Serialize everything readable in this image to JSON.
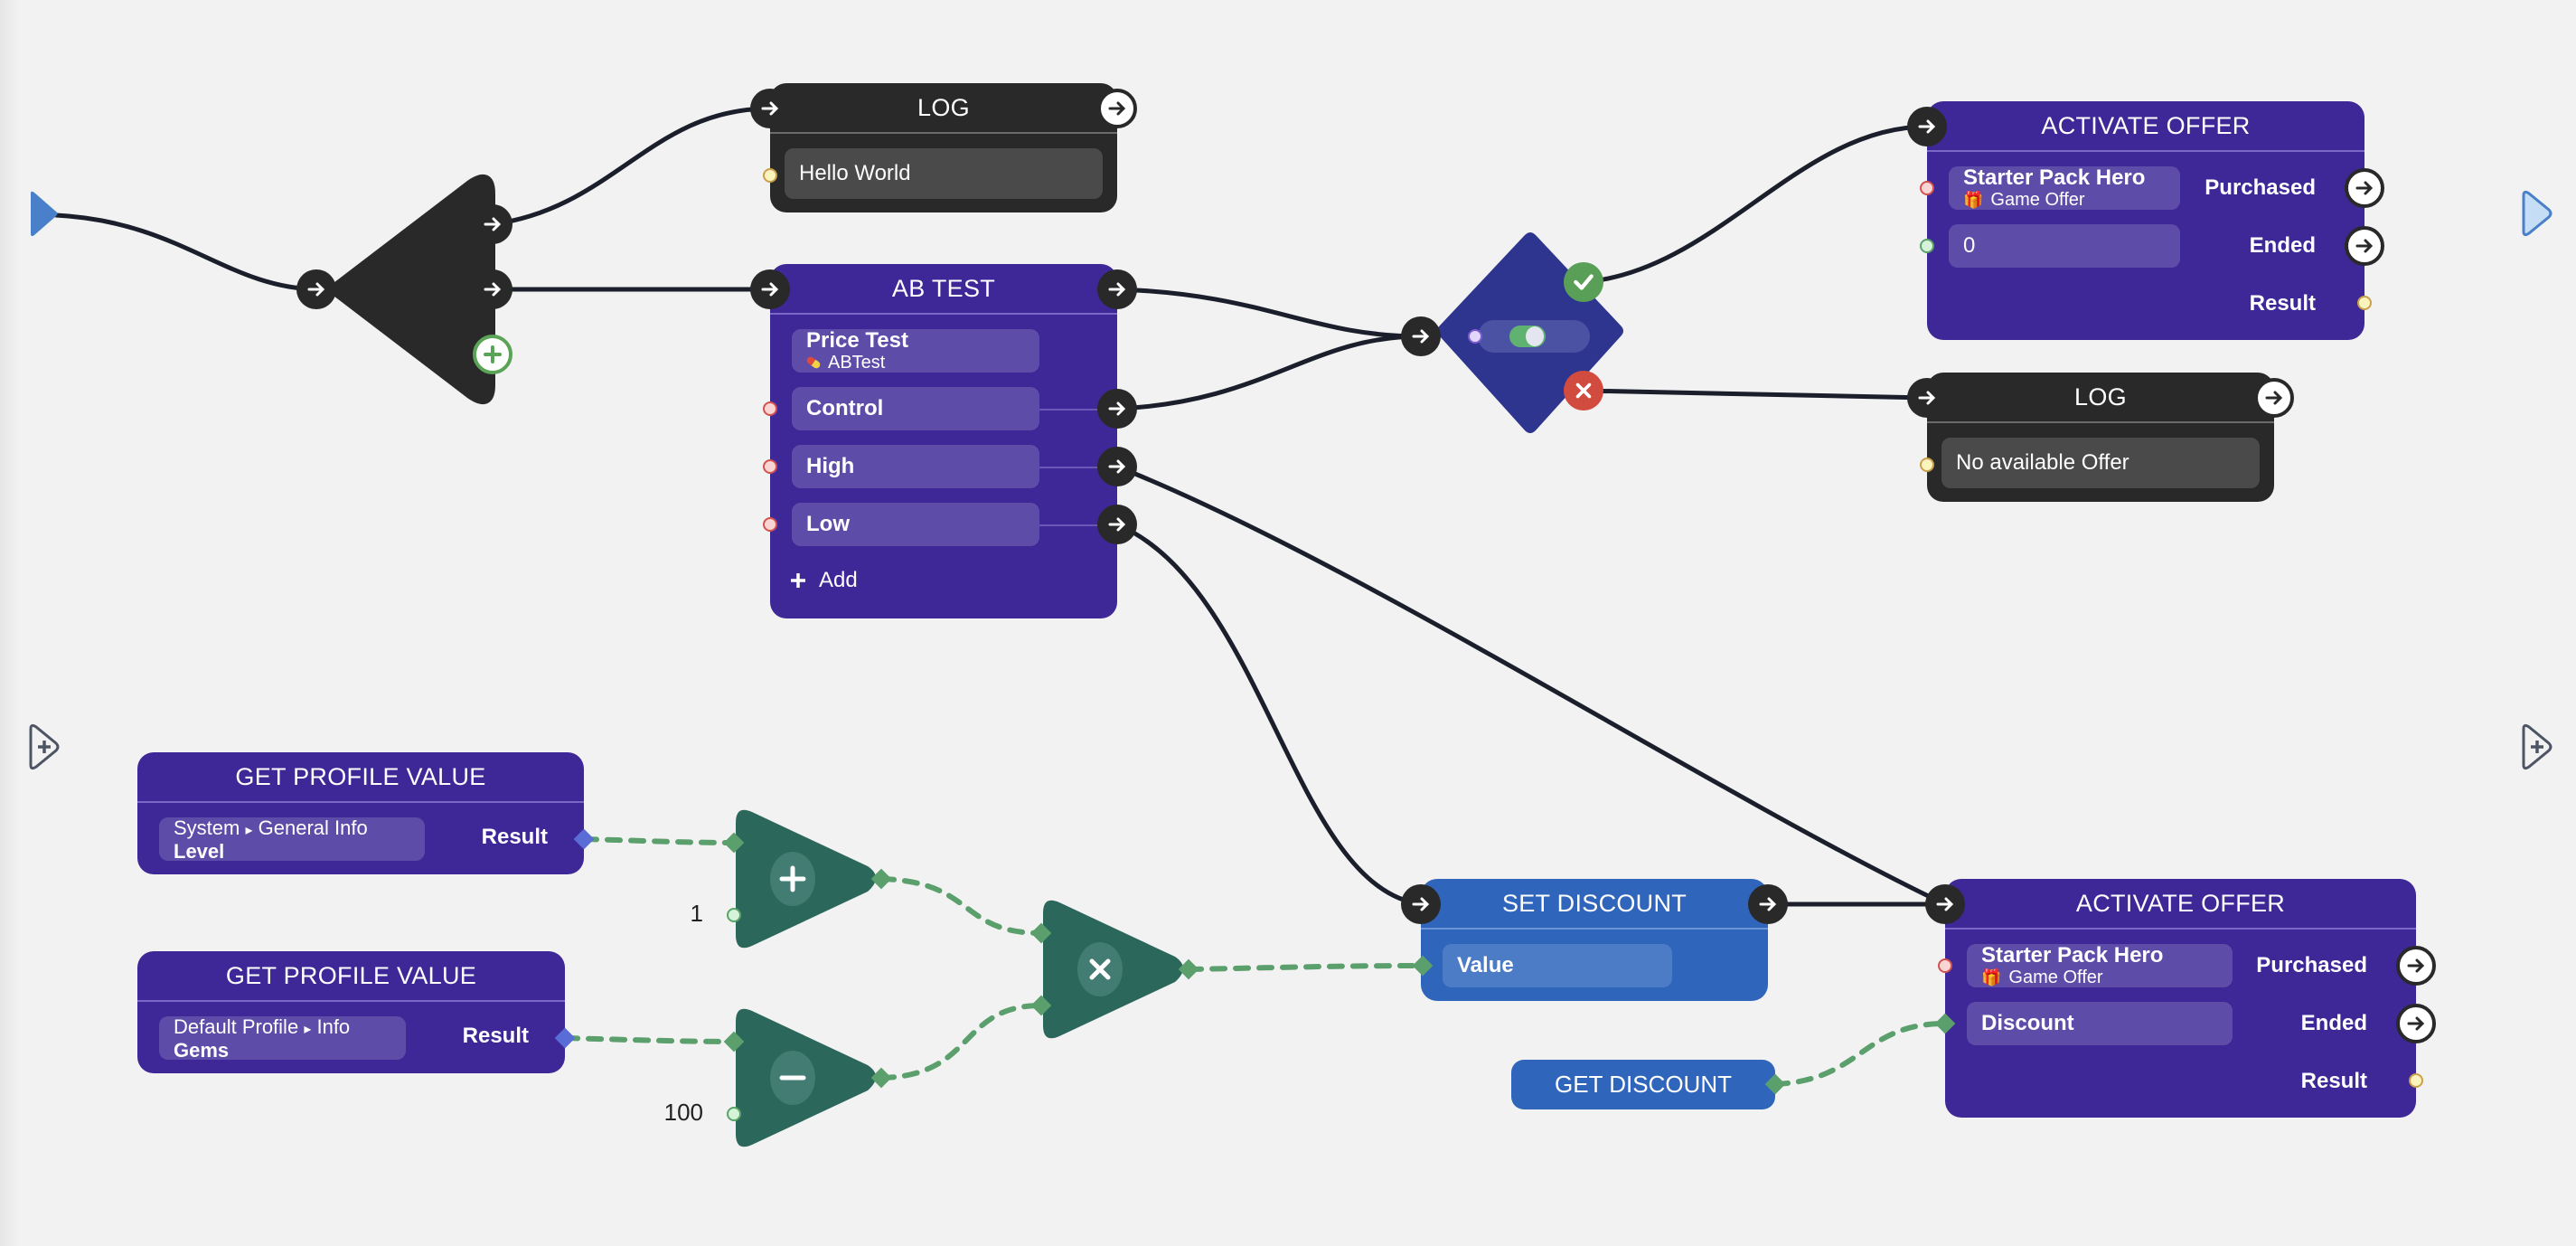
{
  "canvas": {
    "entry_marker": "start-flow",
    "exit_marker": "end-flow",
    "add_entry_marker": "add-input",
    "add_exit_marker": "add-output"
  },
  "colors": {
    "canvas_bg": "#f2f2f2",
    "flow_wire": "#1b1f2b",
    "data_wire": "#5a9f6c",
    "dark_node": "#292929",
    "purple_node": "#3e2898",
    "blue_node": "#3065bc",
    "math_node": "#2b675b",
    "condition_node": "#2d358f",
    "success": "#5a9f57",
    "failure": "#d24b3f",
    "entry_marker": "#4a80c9"
  },
  "nodes": {
    "branch": {
      "type": "sequence",
      "icons": [
        "arrow-right-icon",
        "arrow-right-icon",
        "arrow-right-icon",
        "plus-circle-icon"
      ]
    },
    "log_hello": {
      "title": "LOG",
      "message": "Hello World"
    },
    "ab_test": {
      "title": "AB TEST",
      "test_name": "Price Test",
      "test_type": "ABTest",
      "test_type_icon": "pill-icon",
      "variants": [
        {
          "label": "Control"
        },
        {
          "label": "High"
        },
        {
          "label": "Low"
        }
      ],
      "add_label": "Add"
    },
    "condition": {
      "type": "if",
      "toggle_on": true,
      "true_icon": "check-icon",
      "false_icon": "x-icon"
    },
    "activate_offer_top": {
      "title": "ACTIVATE OFFER",
      "offer_name": "Starter Pack Hero",
      "offer_type": "Game Offer",
      "offer_icon": "gift-icon",
      "discount_value": "0",
      "outputs": [
        "Purchased",
        "Ended",
        "Result"
      ]
    },
    "log_no_offer": {
      "title": "LOG",
      "message": "No available Offer"
    },
    "get_profile_level": {
      "title": "GET PROFILE VALUE",
      "path": "System",
      "path_sep": "▸",
      "path_sub": "General Info",
      "field": "Level",
      "output": "Result"
    },
    "get_profile_gems": {
      "title": "GET PROFILE VALUE",
      "path": "Default Profile",
      "path_sep": "▸",
      "path_sub": "Info",
      "field": "Gems",
      "output": "Result"
    },
    "math_add": {
      "operator": "plus",
      "constant_input": "1"
    },
    "math_subtract": {
      "operator": "minus",
      "constant_input": "100"
    },
    "math_multiply": {
      "operator": "multiply"
    },
    "set_discount": {
      "title": "SET DISCOUNT",
      "input_label": "Value"
    },
    "get_discount": {
      "title": "GET DISCOUNT"
    },
    "activate_offer_bottom": {
      "title": "ACTIVATE OFFER",
      "offer_name": "Starter Pack Hero",
      "offer_type": "Game Offer",
      "offer_icon": "gift-icon",
      "discount_label": "Discount",
      "outputs": [
        "Purchased",
        "Ended",
        "Result"
      ]
    }
  }
}
